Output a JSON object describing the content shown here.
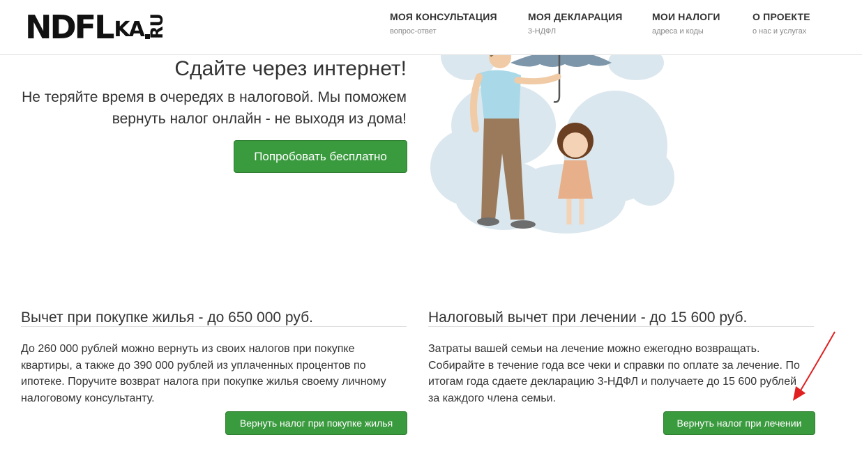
{
  "logo": {
    "main": "NDFL",
    "small": "KA",
    "ru": "RU"
  },
  "nav": [
    {
      "title": "МОЯ КОНСУЛЬТАЦИЯ",
      "sub": "вопрос-ответ"
    },
    {
      "title": "МОЯ ДЕКЛАРАЦИЯ",
      "sub": "3-НДФЛ"
    },
    {
      "title": "МОИ НАЛОГИ",
      "sub": "адреса и коды"
    },
    {
      "title": "О ПРОЕКТЕ",
      "sub": "о нас и услугах"
    }
  ],
  "hero": {
    "title": "Сдайте через интернет!",
    "text": "Не теряйте время в очередях в налоговой. Мы поможем вернуть налог онлайн - не выходя из дома!",
    "button": "Попробовать бесплатно"
  },
  "sections": [
    {
      "title": "Вычет при покупке жилья - до 650 000 руб.",
      "text": "До 260 000 рублей можно вернуть из своих налогов при покупке квартиры, а также до 390 000 рублей из уплаченных процентов по ипотеке. Поручите возврат налога при покупке жилья своему личному налоговому консультанту.",
      "button": "Вернуть налог при покупке жилья"
    },
    {
      "title": "Налоговый вычет при лечении - до 15 600 руб.",
      "text": "Затраты вашей семьи на лечение можно ежегодно возвращать. Собирайте в течение года все чеки и справки по оплате за лечение. По итогам года сдаете декларацию 3-НДФЛ и получаете до 15 600 рублей за каждого члена семьи.",
      "button": "Вернуть налог при лечении"
    }
  ],
  "colors": {
    "button_green": "#3a9a3e",
    "annotation_arrow": "#e02020"
  }
}
